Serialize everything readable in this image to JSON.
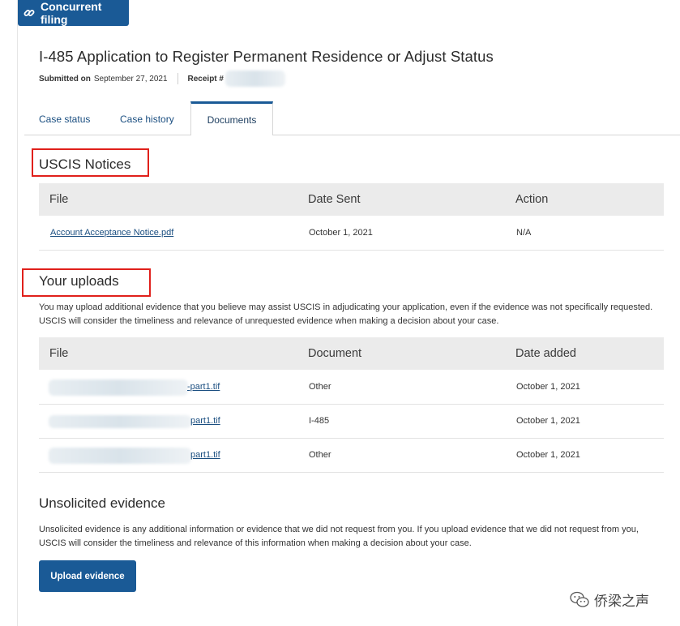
{
  "header": {
    "badge_label": "Concurrent filing",
    "badge_icon": "link-icon",
    "title": "I-485 Application to Register Permanent Residence or Adjust Status",
    "submitted_label": "Submitted on",
    "submitted_date": "September 27, 2021",
    "receipt_label": "Receipt #"
  },
  "tabs": [
    {
      "label": "Case status",
      "active": false
    },
    {
      "label": "Case history",
      "active": false
    },
    {
      "label": "Documents",
      "active": true
    }
  ],
  "notices": {
    "title": "USCIS Notices",
    "columns": [
      "File",
      "Date Sent",
      "Action"
    ],
    "rows": [
      {
        "file": "Account Acceptance Notice.pdf",
        "date_sent": "October 1, 2021",
        "action": "N/A"
      }
    ]
  },
  "uploads": {
    "title": "Your uploads",
    "description": "You may upload additional evidence that you believe may assist USCIS in adjudicating your application, even if the evidence was not specifically requested. USCIS will consider the timeliness and relevance of unrequested evidence when making a decision about your case.",
    "columns": [
      "File",
      "Document",
      "Date added"
    ],
    "rows": [
      {
        "file_suffix": "-part1.tif",
        "document": "Other",
        "date_added": "October 1, 2021"
      },
      {
        "file_suffix": "part1.tif",
        "document": "I-485",
        "date_added": "October 1, 2021"
      },
      {
        "file_suffix": "part1.tif",
        "document": "Other",
        "date_added": "October 1, 2021"
      }
    ]
  },
  "unsolicited": {
    "title": "Unsolicited evidence",
    "description": "Unsolicited evidence is any additional information or evidence that we did not request from you. If you upload evidence that we did not request from you, USCIS will consider the timeliness and relevance of this information when making a decision about your case.",
    "button_label": "Upload evidence"
  },
  "watermark": {
    "text": "侨梁之声",
    "icon": "wechat-icon"
  },
  "colors": {
    "primary": "#1a5a96",
    "link": "#1a4e80",
    "highlight": "#e0201b",
    "table_header": "#ebebeb"
  }
}
